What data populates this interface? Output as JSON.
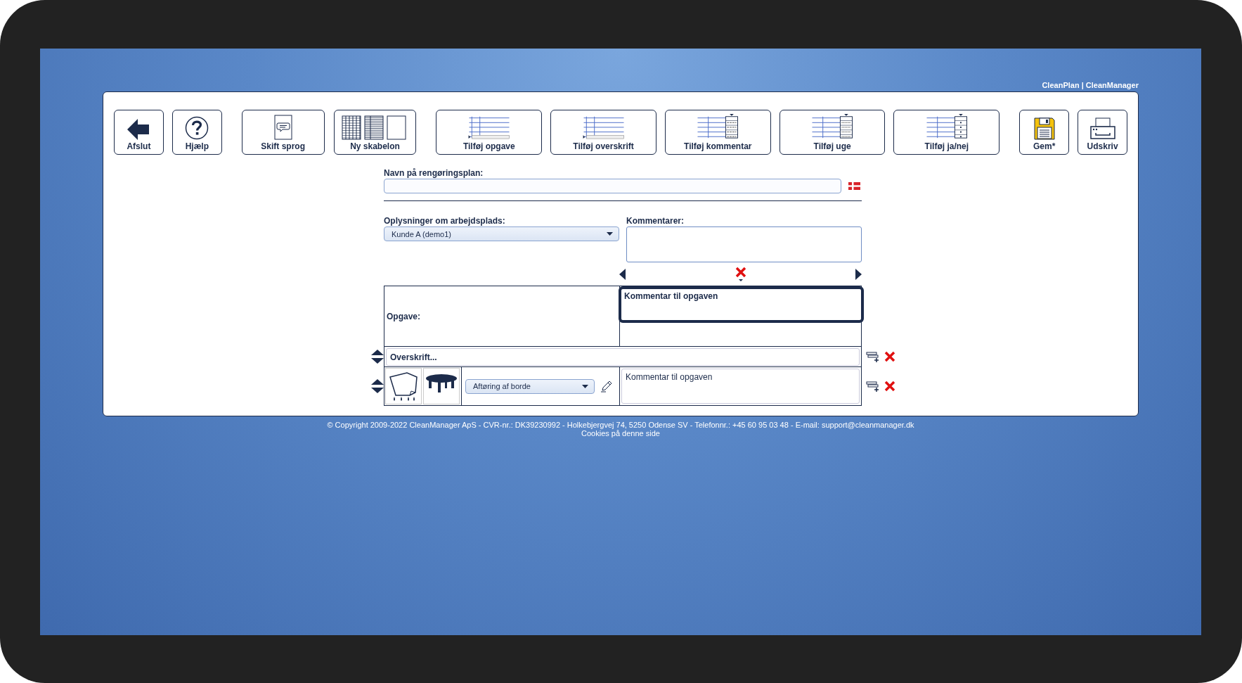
{
  "brand": "CleanPlan | CleanManager",
  "toolbar": [
    {
      "label": "Afslut",
      "kind": "exit"
    },
    {
      "label": "Hjælp",
      "kind": "help"
    },
    {
      "label": "Skift sprog",
      "kind": "language"
    },
    {
      "label": "Ny skabelon",
      "kind": "template"
    },
    {
      "label": "Tilføj opgave",
      "kind": "add-task"
    },
    {
      "label": "Tilføj overskrift",
      "kind": "add-heading"
    },
    {
      "label": "Tilføj kommentar",
      "kind": "add-comment"
    },
    {
      "label": "Tilføj uge",
      "kind": "add-week"
    },
    {
      "label": "Tilføj ja/nej",
      "kind": "add-yesno"
    },
    {
      "label": "Gem*",
      "kind": "save"
    },
    {
      "label": "Udskriv",
      "kind": "print"
    }
  ],
  "plan_name": {
    "label": "Navn på rengøringsplan:"
  },
  "workplace": {
    "label": "Oplysninger om arbejdsplads:",
    "value": "Kunde A (demo1)"
  },
  "comments": {
    "label": "Kommentarer:"
  },
  "task_table": {
    "header_label": "Opgave:",
    "comment_header": "Kommentar til opgaven",
    "heading_row": {
      "value": "Overskrift..."
    },
    "task_rows": [
      {
        "task": "Aftøring af borde",
        "comment": "Kommentar til opgaven"
      }
    ]
  },
  "footer": {
    "copyright": "© Copyright 2009-2022 CleanManager ApS - CVR-nr.: DK39230992 - Holkebjergvej 74, 5250 Odense SV - Telefonnr.: +45 60 95 03 48 - E-mail: support@cleanmanager.dk",
    "link": "Cookies på denne side"
  }
}
